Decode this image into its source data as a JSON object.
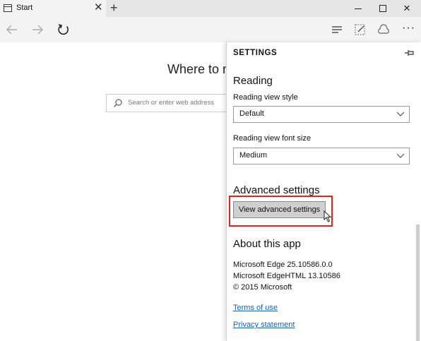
{
  "tab": {
    "title": "Start",
    "close_glyph": "✕",
    "new_tab_glyph": "+"
  },
  "window_controls": {
    "minimize": "minimize-icon",
    "maximize": "maximize-icon",
    "close": "✕"
  },
  "nav": {
    "icons": [
      "back-arrow-icon",
      "forward-arrow-icon",
      "refresh-icon",
      "hub-icon",
      "web-note-icon",
      "share-icon",
      "more-icon"
    ],
    "more_glyph": "···"
  },
  "page": {
    "heading": "Where to n",
    "search_placeholder": "Search or enter web address"
  },
  "settings": {
    "title": "SETTINGS",
    "reading_heading": "Reading",
    "reading_view_style_label": "Reading view style",
    "reading_view_style_value": "Default",
    "reading_view_font_size_label": "Reading view font size",
    "reading_view_font_size_value": "Medium",
    "advanced_heading": "Advanced settings",
    "advanced_button": "View advanced settings",
    "about_heading": "About this app",
    "about_lines": [
      "Microsoft Edge 25.10586.0.0",
      "Microsoft EdgeHTML 13.10586",
      "© 2015 Microsoft"
    ],
    "terms_link": "Terms of use",
    "privacy_link": "Privacy statement"
  },
  "colors": {
    "highlight": "#e0231e",
    "link": "#1a5fb4",
    "titlebar": "#e6e6e6"
  }
}
